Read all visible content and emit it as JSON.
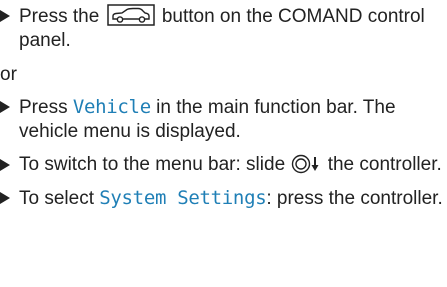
{
  "colors": {
    "text": "#222222",
    "display_text": "#1f7fb6"
  },
  "icons": {
    "bullet": "triangle-right-icon",
    "vehicle_button": "car-button-icon",
    "controller": "controller-slide-down-icon"
  },
  "step1": {
    "pre": "Press the ",
    "post": " button on the COMAND control panel."
  },
  "or_label": "or",
  "step2": {
    "pre": "Press ",
    "display": "Vehicle",
    "post": " in the main function bar. The vehicle menu is displayed."
  },
  "step3": {
    "pre": "To switch to the menu bar: slide ",
    "post": " the controller."
  },
  "step4": {
    "pre": "To select ",
    "display": "System Settings",
    "post": ": press the controller."
  }
}
